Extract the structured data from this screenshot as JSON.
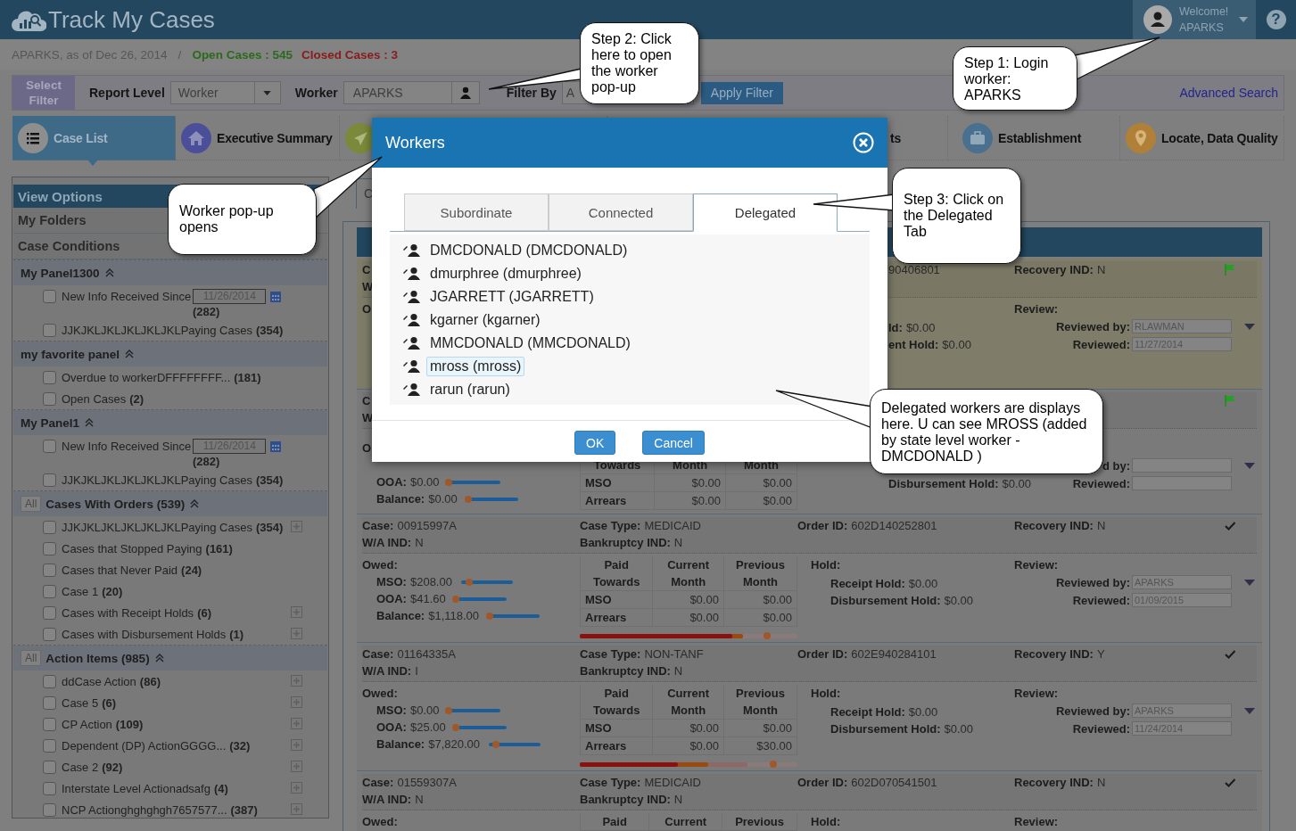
{
  "header": {
    "title": "Track My Cases",
    "welcome": "Welcome!",
    "user": "APARKS",
    "help": "?"
  },
  "summary": {
    "as_of": "APARKS, as of Dec 26, 2014",
    "separator": "/",
    "open_cases": "Open Cases : 545",
    "closed_cases": "Closed Cases : 3"
  },
  "filter_bar": {
    "select_filter": "Select Filter",
    "report_level_label": "Report Level",
    "report_level": "Worker",
    "worker_label": "Worker",
    "worker": "APARKS",
    "filter_by_label": "Filter By",
    "filter_by": "A",
    "apply": "Apply Filter",
    "advanced_search": "Advanced Search"
  },
  "nav_tabs": [
    {
      "label": "Case List",
      "selected": true
    },
    {
      "label": "Executive Summary",
      "selected": false
    },
    {
      "selected": false
    },
    {
      "label": "ts",
      "selected": false
    },
    {
      "label": "Establishment",
      "selected": false
    },
    {
      "label": "Locate, Data Quality",
      "selected": false
    }
  ],
  "sidebar": {
    "title": "View Options",
    "sections": [
      "My Folders",
      "Case Conditions"
    ],
    "panels": [
      {
        "title": "My Panel1300",
        "items": [
          {
            "kind": "date",
            "label": "New Info Received Since",
            "date": "11/26/2014",
            "count": "(282)",
            "checked": false,
            "expandable": false
          },
          {
            "kind": "plain",
            "label": "JJKJKLJKLJKLJKLJKLPaying Cases",
            "count": "(354)",
            "checked": false,
            "expandable": false
          }
        ]
      },
      {
        "title": "my favorite panel",
        "items": [
          {
            "kind": "plain",
            "label": "Overdue to workerDFFFFFFFF...",
            "count": "(181)",
            "checked": false,
            "expandable": false
          },
          {
            "kind": "plain",
            "label": "Open Cases",
            "count": "(2)",
            "checked": false,
            "expandable": false
          }
        ]
      },
      {
        "title": "My Panel1",
        "items": [
          {
            "kind": "date",
            "label": "New Info Received Since",
            "date": "11/26/2014",
            "count": "(282)",
            "checked": false,
            "expandable": false
          },
          {
            "kind": "plain",
            "label": "JJKJKLJKLJKLJKLJKLPaying Cases",
            "count": "(354)",
            "checked": false,
            "expandable": false
          }
        ]
      },
      {
        "all_button": "All",
        "title": "Cases With Orders (539)",
        "items": [
          {
            "kind": "plain",
            "label": "JJKJKLJKLJKLJKLJKLPaying Cases",
            "count": "(354)",
            "checked": false,
            "expandable": true
          },
          {
            "kind": "plain",
            "label": "Cases that Stopped Paying",
            "count": "(161)",
            "checked": false,
            "expandable": false
          },
          {
            "kind": "plain",
            "label": "Cases that Never Paid",
            "count": "(24)",
            "checked": false,
            "expandable": false
          },
          {
            "kind": "plain",
            "label": "Case 1",
            "count": "(20)",
            "checked": false,
            "expandable": false
          },
          {
            "kind": "plain",
            "label": "Cases with Receipt Holds",
            "count": "(6)",
            "checked": false,
            "expandable": true
          },
          {
            "kind": "plain",
            "label": "Cases with Disbursement Holds",
            "count": "(1)",
            "checked": false,
            "expandable": true
          }
        ]
      },
      {
        "all_button": "All",
        "title": "Action Items (985)",
        "items": [
          {
            "kind": "plain",
            "label": "ddCase Action",
            "count": "(86)",
            "checked": false,
            "expandable": true
          },
          {
            "kind": "plain",
            "label": "Case 5",
            "count": "(6)",
            "checked": false,
            "expandable": true
          },
          {
            "kind": "plain",
            "label": "CP Action",
            "count": "(109)",
            "checked": false,
            "expandable": true
          },
          {
            "kind": "plain",
            "label": "Dependent (DP) ActionGGGG...",
            "count": "(32)",
            "checked": false,
            "expandable": true
          },
          {
            "kind": "plain",
            "label": "Case 2",
            "count": "(92)",
            "checked": false,
            "expandable": true
          },
          {
            "kind": "plain",
            "label": "Interstate Level Actionadsafg",
            "count": "(4)",
            "checked": false,
            "expandable": true
          },
          {
            "kind": "plain",
            "label": "NCP Actionghghghgh7657577...",
            "count": "(387)",
            "checked": false,
            "expandable": true
          }
        ]
      }
    ]
  },
  "main": {
    "tab_fragment": "C",
    "cards": [
      {
        "highlighted": true,
        "flagged": true,
        "case": {
          "label": "C"
        },
        "order_id": {
          "value": "90406801"
        },
        "recovery": {
          "label": "Recovery IND:",
          "value": "N"
        },
        "wa_ind": {
          "label": "W"
        },
        "owed_title": "O",
        "holds": [
          {
            "label": "ld:",
            "value": "$0.00"
          },
          {
            "label": "ent Hold:",
            "value": "$0.00"
          }
        ],
        "review_title": "Review:",
        "review": [
          {
            "label": "Reviewed by:",
            "value": "RLAWMAN"
          },
          {
            "label": "Reviewed:",
            "value": "11/27/2014"
          }
        ]
      },
      {
        "highlighted": false,
        "flagged": true,
        "case": {
          "label": "C"
        },
        "wa_ind": {
          "label": "W"
        },
        "owed_title": "O",
        "owed": [
          {
            "label": "OOA:",
            "value": "$0.00",
            "level": 0
          },
          {
            "label": "Balance:",
            "value": "$0.00",
            "level": 0.03
          }
        ],
        "table": {
          "header": [
            "Towards",
            "Month",
            "Month"
          ],
          "rows": [
            [
              "MSO",
              "$0.00",
              "$0.00"
            ],
            [
              "Arrears",
              "$0.00",
              "$0.00"
            ]
          ]
        },
        "holds": [
          {
            "label": "Disbursement Hold:",
            "value": "$0.00"
          }
        ],
        "review": [
          {
            "label": "d by:"
          },
          {
            "label": "Reviewed:"
          }
        ]
      },
      {
        "highlighted": false,
        "flagged": false,
        "case": {
          "label": "Case:",
          "value": "00915997A"
        },
        "case_type": {
          "label": "Case Type:",
          "value": "MEDICAID"
        },
        "order_id": {
          "label": "Order ID:",
          "value": "602D140252801"
        },
        "recovery": {
          "label": "Recovery IND:",
          "value": "N"
        },
        "wa_ind": {
          "label": "W/A IND:",
          "value": "N"
        },
        "bankruptcy": {
          "label": "Bankruptcy IND:",
          "value": "N"
        },
        "owed_title": "Owed:",
        "owed": [
          {
            "label": "MSO:",
            "value": "$208.00",
            "level": 0.16
          },
          {
            "label": "OOA:",
            "value": "$41.60",
            "level": 0.02
          },
          {
            "label": "Balance:",
            "value": "$1,118.00",
            "level": 0.03
          }
        ],
        "table": {
          "header": [
            "Paid Towards",
            "Current Month",
            "Previous Month"
          ],
          "rows": [
            [
              "MSO",
              "$0.00",
              "$0.00"
            ],
            [
              "Arrears",
              "$0.00",
              "$0.00"
            ]
          ]
        },
        "progress": {
          "segments": [
            {
              "level": 0.7
            },
            {
              "level": 0.75
            }
          ],
          "marker": {
            "level": 0.86
          }
        },
        "hold_title": "Hold:",
        "holds": [
          {
            "label": "Receipt Hold:",
            "value": "$0.00"
          },
          {
            "label": "Disbursement Hold:",
            "value": "$0.00"
          }
        ],
        "review_title": "Review:",
        "review": [
          {
            "label": "Reviewed by:",
            "value": "APARKS"
          },
          {
            "label": "Reviewed:",
            "value": "01/09/2015"
          }
        ]
      },
      {
        "highlighted": false,
        "flagged": false,
        "case": {
          "label": "Case:",
          "value": "01164335A"
        },
        "case_type": {
          "label": "Case Type:",
          "value": "NON-TANF"
        },
        "order_id": {
          "label": "Order ID:",
          "value": "602E940284101"
        },
        "recovery": {
          "label": "Recovery IND:",
          "value": "Y"
        },
        "wa_ind": {
          "label": "W/A IND:",
          "value": "I"
        },
        "bankruptcy": {
          "label": "Bankruptcy IND:",
          "value": "N"
        },
        "owed_title": "Owed:",
        "owed": [
          {
            "label": "MSO:",
            "value": "$0.00",
            "level": 0
          },
          {
            "label": "OOA:",
            "value": "$25.00",
            "level": 0.02
          },
          {
            "label": "Balance:",
            "value": "$7,820.00",
            "level": 0.13
          }
        ],
        "table": {
          "header": [
            "Paid Towards",
            "Current Month",
            "Previous Month"
          ],
          "rows": [
            [
              "MSO",
              "$0.00",
              "$0.00"
            ],
            [
              "Arrears",
              "$0.00",
              "$30.00"
            ]
          ]
        },
        "progress": {
          "segments": [
            {
              "level": 0.45
            },
            {
              "level": 0.59
            },
            {
              "level": 0.77
            }
          ],
          "marker": {
            "level": 0.89
          }
        },
        "hold_title": "Hold:",
        "holds": [
          {
            "label": "Receipt Hold:",
            "value": "$0.00"
          },
          {
            "label": "Disbursement Hold:",
            "value": "$0.00"
          }
        ],
        "review_title": "Review:",
        "review": [
          {
            "label": "Reviewed by:",
            "value": "APARKS"
          },
          {
            "label": "Reviewed:",
            "value": "11/24/2014"
          }
        ]
      },
      {
        "highlighted": false,
        "flagged": false,
        "case": {
          "label": "Case:",
          "value": "01559307A"
        },
        "case_type": {
          "label": "Case Type:",
          "value": "MEDICAID"
        },
        "order_id": {
          "label": "Order ID:",
          "value": "602D070541501"
        },
        "recovery": {
          "label": "Recovery IND:",
          "value": "N"
        },
        "wa_ind": {
          "label": "W/A IND:",
          "value": "N"
        },
        "bankruptcy": {
          "label": "Bankruptcy IND:",
          "value": "N"
        },
        "owed_title": "Owed:",
        "table": {
          "header": [
            "Paid",
            "Current",
            "Previous"
          ]
        },
        "hold_title": "Hold:",
        "review_title": "Review:"
      }
    ]
  },
  "modal": {
    "title": "Workers",
    "tabs": [
      {
        "label": "Subordinate",
        "selected": false
      },
      {
        "label": "Connected",
        "selected": false
      },
      {
        "label": "Delegated",
        "selected": true
      }
    ],
    "workers": [
      {
        "name": "DMCDONALD (DMCDONALD)",
        "selected": false
      },
      {
        "name": "dmurphree (dmurphree)",
        "selected": false
      },
      {
        "name": "JGARRETT (JGARRETT)",
        "selected": false
      },
      {
        "name": "kgarner (kgarner)",
        "selected": false
      },
      {
        "name": "MMCDONALD (MMCDONALD)",
        "selected": false
      },
      {
        "name": "mross (mross)",
        "selected": true
      },
      {
        "name": "rarun (rarun)",
        "selected": false
      }
    ],
    "ok": "OK",
    "cancel": "Cancel"
  },
  "callouts": [
    {
      "text": "Step 2: Click here to open the worker pop-up"
    },
    {
      "text": "Step 1: Login worker: APARKS"
    },
    {
      "text": "Worker pop-up opens"
    },
    {
      "text": "Step 3: Click on the Delegated Tab"
    },
    {
      "text": "Delegated workers are displays here. U can see MROSS (added by state level worker - DMCDONALD )"
    }
  ]
}
